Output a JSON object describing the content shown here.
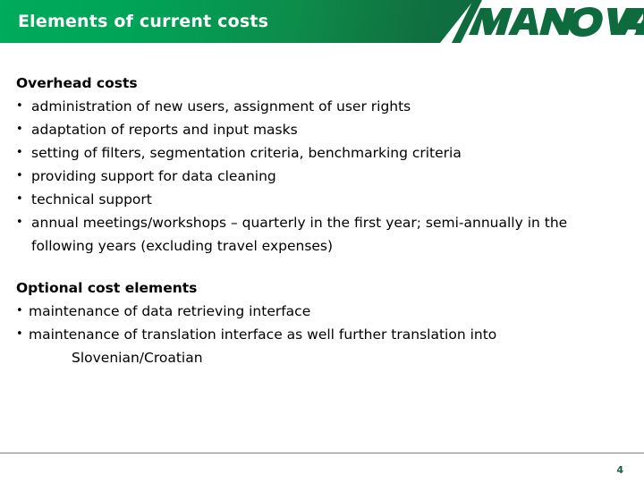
{
  "header": {
    "title": "Elements of current costs",
    "logo_text": "MANOVA",
    "bar_gradient_from": "#00ab5b",
    "bar_gradient_to": "#0e6b3e",
    "title_color": "#ffffff",
    "logo_color": "#0e6b3e"
  },
  "sections": [
    {
      "heading": "Overhead costs",
      "bullet_marker": "•",
      "bullets": [
        "administration of new users, assignment of user rights",
        "adaptation of reports and input masks",
        "setting of filters, segmentation criteria, benchmarking criteria",
        "providing support for data cleaning",
        "technical support",
        "annual meetings/workshops – quarterly in the first year; semi-annually in the following years (excluding travel expenses)"
      ]
    },
    {
      "heading": "Optional cost elements",
      "bullet_marker": "•",
      "bullets": [
        "maintenance of data retrieving interface",
        "maintenance of translation interface as well further translation into"
      ],
      "subline": "Slovenian/Croatian"
    }
  ],
  "footer": {
    "page_number": "4",
    "page_number_color": "#17604a",
    "rule_color": "#808285"
  }
}
